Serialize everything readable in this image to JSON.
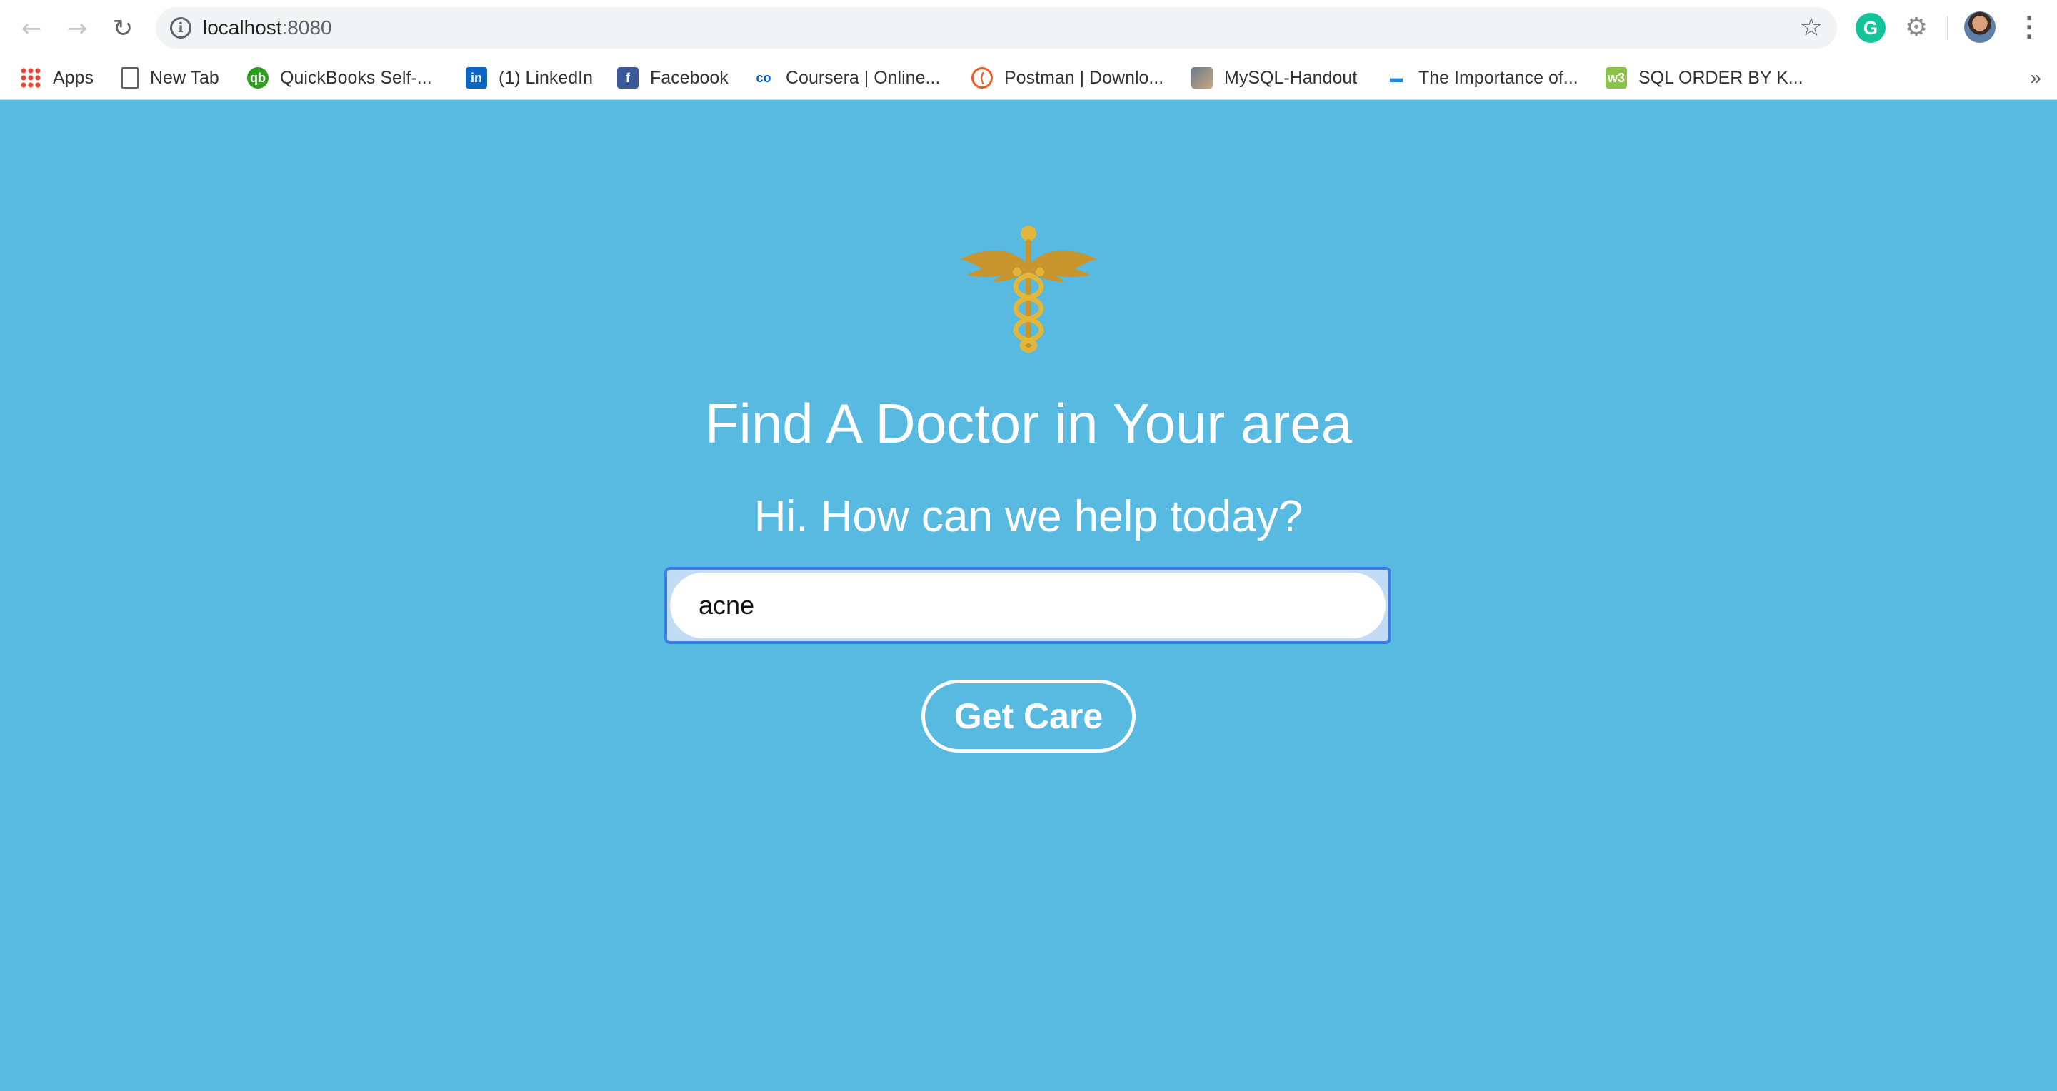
{
  "browser": {
    "url_host": "localhost",
    "url_port": ":8080",
    "grammarly_letter": "G",
    "menu_glyph": "⋮",
    "more_bookmarks_glyph": "»"
  },
  "bookmarks": [
    {
      "label": "Apps",
      "icon": "apps-grid-icon"
    },
    {
      "label": "New Tab",
      "icon": "page-icon"
    },
    {
      "label": "QuickBooks Self-...",
      "icon": "quickbooks-icon",
      "glyph": "qb"
    },
    {
      "label": "(1) LinkedIn",
      "icon": "linkedin-icon",
      "glyph": "in"
    },
    {
      "label": "Facebook",
      "icon": "facebook-icon",
      "glyph": "f"
    },
    {
      "label": "Coursera | Online...",
      "icon": "coursera-icon",
      "glyph": "co"
    },
    {
      "label": "Postman | Downlo...",
      "icon": "postman-icon",
      "glyph": "⟨"
    },
    {
      "label": "MySQL-Handout",
      "icon": "mysql-icon"
    },
    {
      "label": "The Importance of...",
      "icon": "article-icon",
      "glyph": "▬"
    },
    {
      "label": "SQL ORDER BY K...",
      "icon": "w3schools-icon",
      "glyph": "w3"
    }
  ],
  "page": {
    "headline": "Find A Doctor in Your area",
    "subhead": "Hi. How can we help today?",
    "search_value": "acne",
    "button_label": "Get Care"
  },
  "colors": {
    "background": "#58b9e1",
    "logo_gold": "#d4a431"
  }
}
